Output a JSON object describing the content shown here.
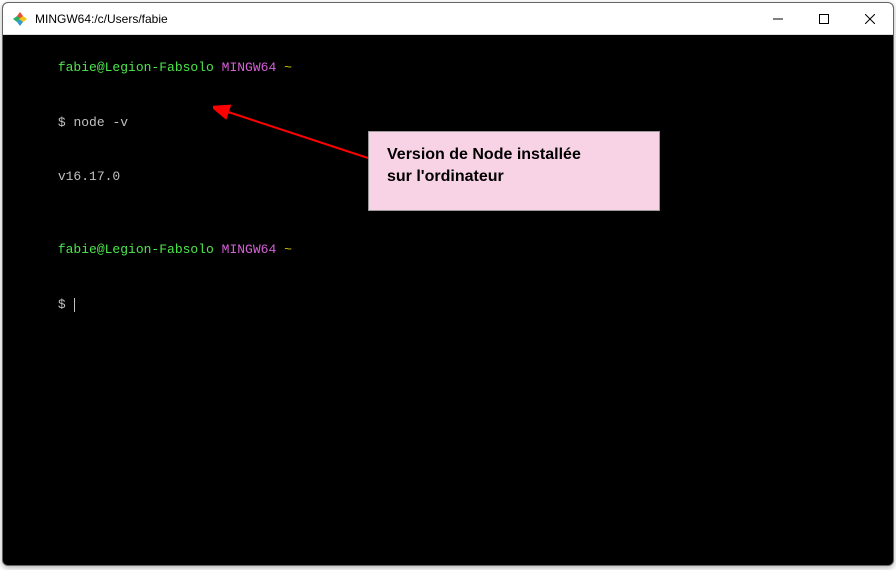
{
  "window": {
    "title": "MINGW64:/c/Users/fabie"
  },
  "terminal": {
    "prompt1": {
      "user": "fabie@Legion-Fabsolo",
      "env": "MINGW64",
      "path": "~"
    },
    "command1": {
      "symbol": "$",
      "text": "node -v"
    },
    "output1": "v16.17.0",
    "prompt2": {
      "user": "fabie@Legion-Fabsolo",
      "env": "MINGW64",
      "path": "~"
    },
    "command2": {
      "symbol": "$"
    }
  },
  "annotation": {
    "line1": "Version de Node installée",
    "line2": "sur l'ordinateur"
  }
}
